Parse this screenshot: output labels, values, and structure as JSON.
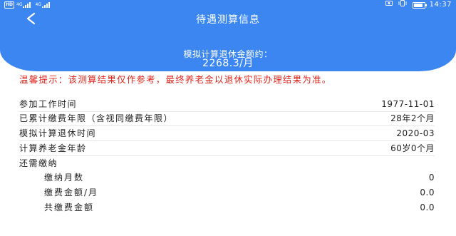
{
  "status_bar": {
    "hd": "HD",
    "net1": "4G",
    "net2": "4G",
    "battery_level": 0.85,
    "time": "14:37"
  },
  "header": {
    "title": "待遇测算信息",
    "estimate_label": "模拟计算退休金额约：",
    "estimate_value": "2268.3/月"
  },
  "warning": "温馨提示：该测算结果仅作参考，最终养老金以退休实际办理结果为准。",
  "rows": [
    {
      "label": "参加工作时间",
      "value": "1977-11-01"
    },
    {
      "label": "已累计缴费年限（含视同缴费年限）",
      "value": "28年2个月"
    },
    {
      "label": "模拟计算退休时间",
      "value": "2020-03"
    },
    {
      "label": "计算养老金年龄",
      "value": "60岁0个月"
    }
  ],
  "remaining": {
    "title": "还需缴纳",
    "items": [
      {
        "label": "缴纳月数",
        "value": "0"
      },
      {
        "label": "缴费金额/月",
        "value": "0.0"
      },
      {
        "label": "共缴费金额",
        "value": "0.0"
      }
    ]
  }
}
